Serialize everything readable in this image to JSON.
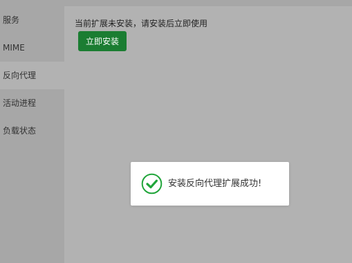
{
  "sidebar": {
    "items": [
      {
        "label": "服务"
      },
      {
        "label": "MIME"
      },
      {
        "label": "反向代理",
        "active": true
      },
      {
        "label": "活动进程"
      },
      {
        "label": "负载状态"
      }
    ]
  },
  "main": {
    "notice": "当前扩展未安装，请安装后立即使用",
    "install_button_label": "立即安装"
  },
  "toast": {
    "icon": "check-circle-icon",
    "message": "安装反向代理扩展成功!"
  },
  "colors": {
    "overlay_bg": "#b2b2b2",
    "sidebar_bg": "#a7a7a7",
    "button_green": "#1b7d32",
    "success_icon": "#20a53a"
  }
}
